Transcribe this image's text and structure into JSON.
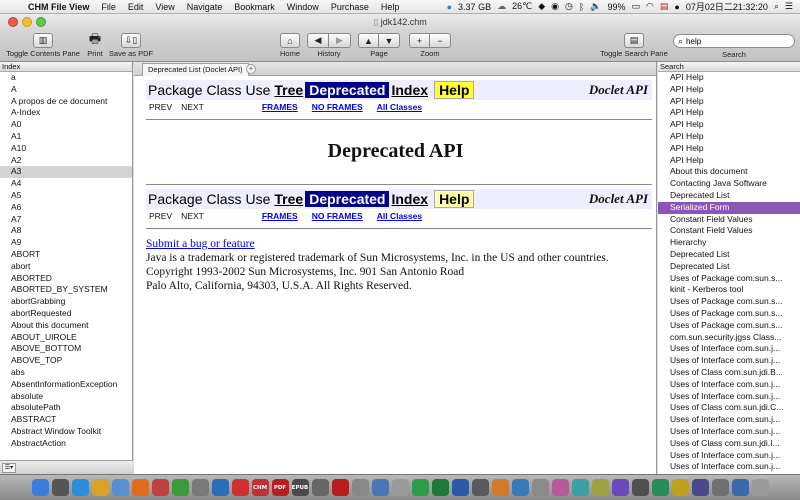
{
  "menubar": {
    "app_name": "CHM File View",
    "menus": [
      "File",
      "Edit",
      "View",
      "Navigate",
      "Bookmark",
      "Window",
      "Purchase",
      "Help"
    ],
    "status": {
      "disk": "3.37 GB",
      "temperature": "26℃",
      "battery": "99%",
      "datetime": "07月02日二21:32:20"
    }
  },
  "window": {
    "title": "jdk142.chm"
  },
  "toolbar": {
    "toggle_contents_label": "Toggle Contents Pane",
    "print_label": "Print",
    "save_pdf_label": "Save as PDF",
    "home_label": "Home",
    "history_label": "History",
    "page_label": "Page",
    "zoom_label": "Zoom",
    "zoom_in": "+",
    "zoom_out": "−",
    "toggle_search_label": "Toggle Search Pane",
    "search_label": "Search",
    "search_value": "help"
  },
  "index_pane": {
    "header": "Index",
    "selected_index": 8,
    "items": [
      "a",
      "A",
      "A propos de ce document",
      "A-Index",
      "A0",
      "A1",
      "A10",
      "A2",
      "A3",
      "A4",
      "A5",
      "A6",
      "A7",
      "A8",
      "A9",
      "ABORT",
      "abort",
      "ABORTED",
      "ABORTED_BY_SYSTEM",
      "abortGrabbing",
      "abortRequested",
      "About this document",
      "ABOUT_UIROLE",
      "ABOVE_BOTTOM",
      "ABOVE_TOP",
      "abs",
      "AbsentInformationException",
      "absolute",
      "absolutePath",
      "ABSTRACT",
      "Abstract Window Toolkit",
      "AbstractAction"
    ]
  },
  "content": {
    "tab_label": "Deprecated List (Doclet API)",
    "navbar": {
      "package": "Package",
      "class": "Class",
      "use": "Use",
      "tree": "Tree",
      "deprecated": "Deprecated",
      "index": "Index",
      "help": "Help",
      "doclet": "Doclet API",
      "prev": "PREV",
      "next": "NEXT",
      "frames": "FRAMES",
      "no_frames": "NO FRAMES",
      "all_classes": "All Classes"
    },
    "title": "Deprecated API",
    "footer": {
      "link": "Submit a bug or feature",
      "line1": "Java is a trademark or registered trademark of Sun Microsystems, Inc. in the US and other countries.",
      "line2": "Copyright 1993-2002 Sun Microsystems, Inc. 901 San Antonio Road",
      "line3": "Palo Alto, California, 94303, U.S.A. All Rights Reserved."
    }
  },
  "search_pane": {
    "header": "Search",
    "selected_index": 11,
    "results": [
      "API Help",
      "API Help",
      "API Help",
      "API Help",
      "API Help",
      "API Help",
      "API Help",
      "API Help",
      "About this document",
      "Contacting Java Software",
      "Deprecated List",
      "Serialized Form",
      "Constant Field Values",
      "Constant Field Values",
      "Hierarchy",
      "Deprecated List",
      "Deprecated List",
      "Uses of Package com.sun.s...",
      "kinit - Kerberos tool",
      "Uses of Package com.sun.s...",
      "Uses of Package com.sun.s...",
      "Uses of Package com.sun.s...",
      "com.sun.security.jgss Class...",
      "Uses of Interface com.sun.j...",
      "Uses of Interface com.sun.j...",
      "Uses of Class com.sun.jdi.B...",
      "Uses of Interface com.sun.j...",
      "Uses of Interface com.sun.j...",
      "Uses of Class com.sun.jdi.C...",
      "Uses of Interface com.sun.j...",
      "Uses of Interface com.sun.j...",
      "Uses of Class com.sun.jdi.I...",
      "Uses of Interface com.sun.j...",
      "Uses of Interface com.sun.j..."
    ]
  },
  "dock": {
    "icons": [
      {
        "name": "finder-icon",
        "color": "#3b7dd8",
        "label": ""
      },
      {
        "name": "launchpad-icon",
        "color": "#555555",
        "label": ""
      },
      {
        "name": "safari-icon",
        "color": "#2a8fd8",
        "label": ""
      },
      {
        "name": "chrome-icon",
        "color": "#d9a02b",
        "label": ""
      },
      {
        "name": "mail-icon",
        "color": "#5a8fd0",
        "label": ""
      },
      {
        "name": "firefox-icon",
        "color": "#e06a1d",
        "label": ""
      },
      {
        "name": "app-icon",
        "color": "#c04040",
        "label": ""
      },
      {
        "name": "app-icon",
        "color": "#3a9b3a",
        "label": ""
      },
      {
        "name": "app-icon",
        "color": "#7a7a7a",
        "label": ""
      },
      {
        "name": "app-icon",
        "color": "#2d6db8",
        "label": ""
      },
      {
        "name": "app-icon",
        "color": "#d03030",
        "label": ""
      },
      {
        "name": "chm-icon",
        "color": "#c03030",
        "label": "CHM"
      },
      {
        "name": "pdf-icon",
        "color": "#b82020",
        "label": "PDF"
      },
      {
        "name": "epub-icon",
        "color": "#4a4a4a",
        "label": "EPUB"
      },
      {
        "name": "app-icon",
        "color": "#666666",
        "label": ""
      },
      {
        "name": "acrobat-icon",
        "color": "#b81d1d",
        "label": ""
      },
      {
        "name": "app-icon",
        "color": "#888888",
        "label": ""
      },
      {
        "name": "app-icon",
        "color": "#4a76b8",
        "label": ""
      },
      {
        "name": "app-icon",
        "color": "#999999",
        "label": ""
      },
      {
        "name": "app-icon",
        "color": "#2f9c4a",
        "label": ""
      },
      {
        "name": "excel-icon",
        "color": "#1f7a3a",
        "label": ""
      },
      {
        "name": "word-icon",
        "color": "#2a5aa8",
        "label": ""
      },
      {
        "name": "app-icon",
        "color": "#5a5a5a",
        "label": ""
      },
      {
        "name": "app-icon",
        "color": "#d07a2a",
        "label": ""
      },
      {
        "name": "app-icon",
        "color": "#3a7ab8",
        "label": ""
      },
      {
        "name": "app-icon",
        "color": "#8a8a8a",
        "label": ""
      },
      {
        "name": "app-icon",
        "color": "#b85a9a",
        "label": ""
      },
      {
        "name": "app-icon",
        "color": "#3aa0a0",
        "label": ""
      },
      {
        "name": "app-icon",
        "color": "#a0a040",
        "label": ""
      },
      {
        "name": "app-icon",
        "color": "#6a4ab8",
        "label": ""
      },
      {
        "name": "app-icon",
        "color": "#505050",
        "label": ""
      },
      {
        "name": "app-icon",
        "color": "#2a8a5a",
        "label": ""
      },
      {
        "name": "app-icon",
        "color": "#c0a020",
        "label": ""
      },
      {
        "name": "app-icon",
        "color": "#4a4a8a",
        "label": ""
      },
      {
        "name": "app-icon",
        "color": "#707070",
        "label": ""
      },
      {
        "name": "app-icon",
        "color": "#3a6aa8",
        "label": ""
      },
      {
        "name": "trash-icon",
        "color": "#9a9a9a",
        "label": ""
      }
    ]
  }
}
